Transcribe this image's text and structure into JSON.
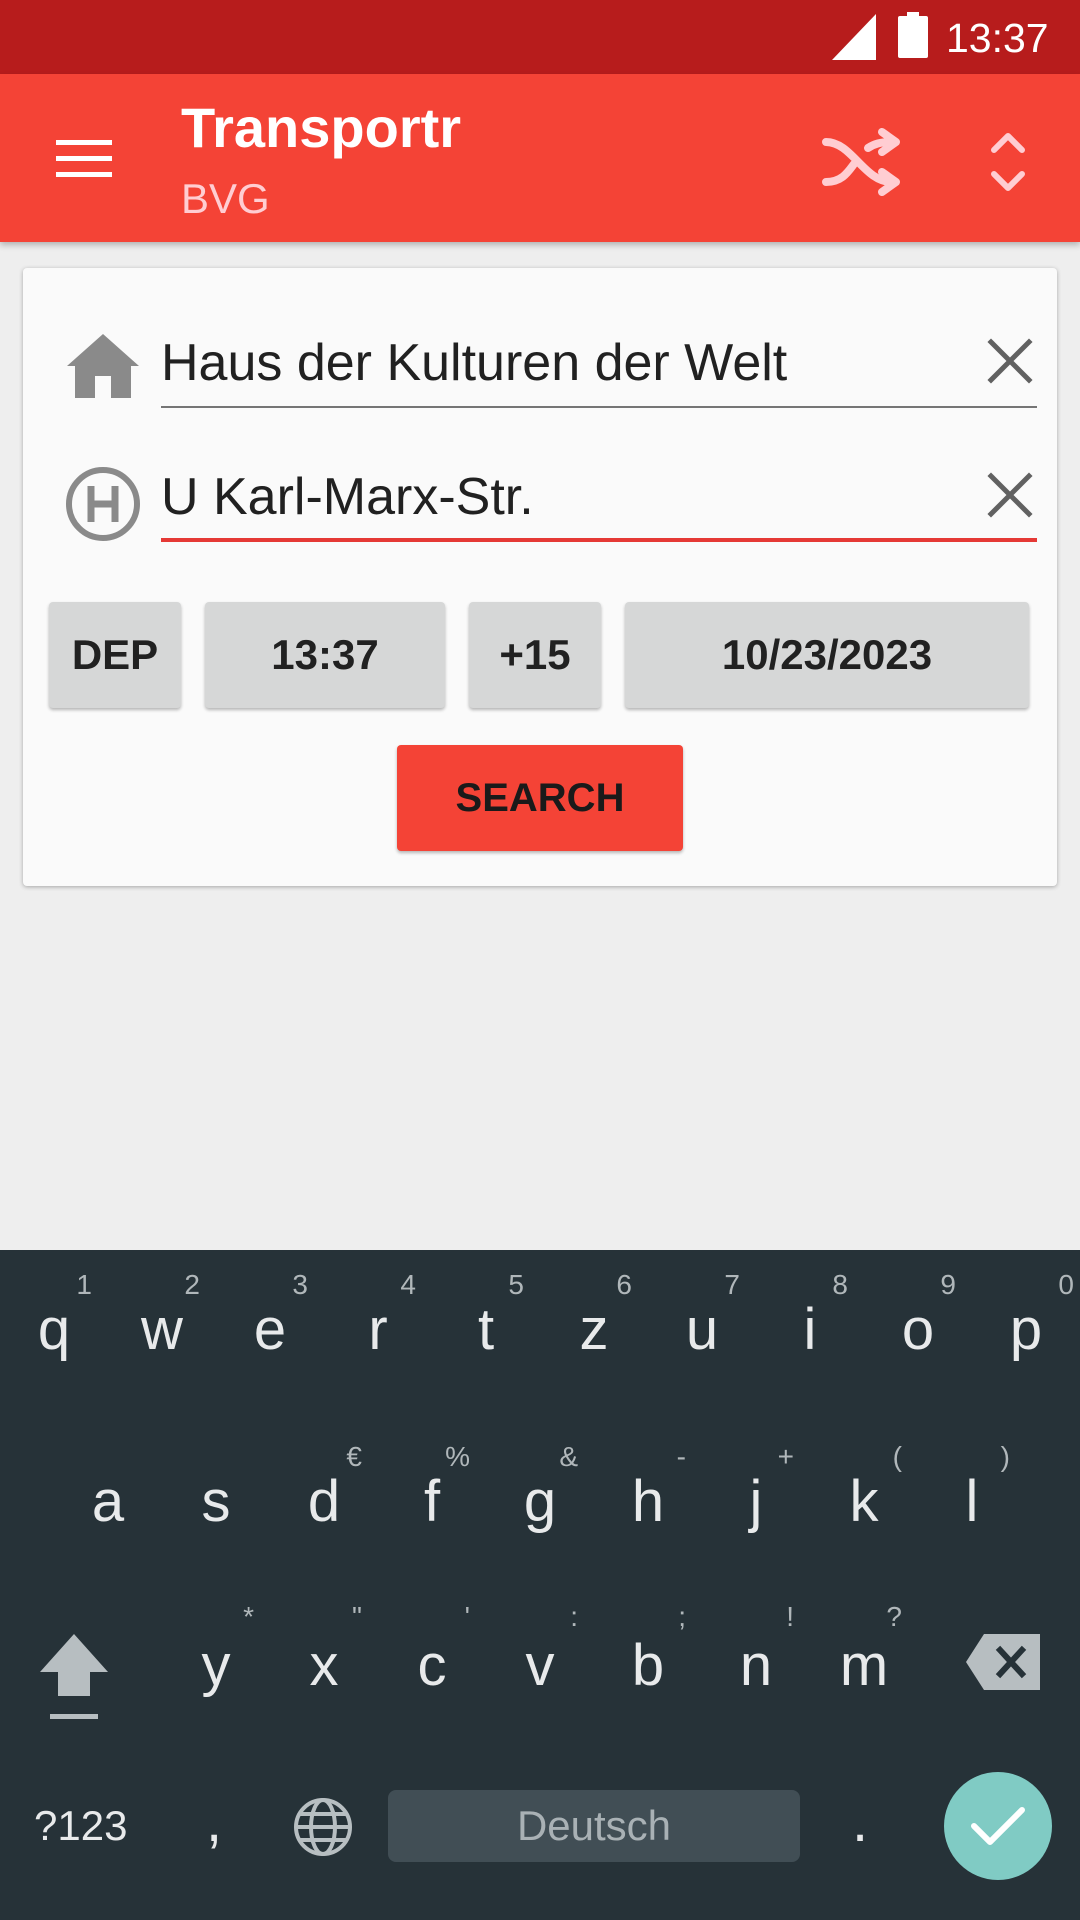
{
  "status_bar": {
    "time": "13:37"
  },
  "app_bar": {
    "title": "Transportr",
    "subtitle": "BVG"
  },
  "search_form": {
    "from": {
      "value": "Haus der Kulturen der Welt"
    },
    "to": {
      "value": "U Karl-Marx-Str."
    },
    "departure_label": "DEP",
    "time": "13:37",
    "time_offset": "+15",
    "date": "10/23/2023",
    "search_label": "SEARCH"
  },
  "keyboard": {
    "row1": [
      {
        "key": "q",
        "hint": "1"
      },
      {
        "key": "w",
        "hint": "2"
      },
      {
        "key": "e",
        "hint": "3"
      },
      {
        "key": "r",
        "hint": "4"
      },
      {
        "key": "t",
        "hint": "5"
      },
      {
        "key": "z",
        "hint": "6"
      },
      {
        "key": "u",
        "hint": "7"
      },
      {
        "key": "i",
        "hint": "8"
      },
      {
        "key": "o",
        "hint": "9"
      },
      {
        "key": "p",
        "hint": "0"
      }
    ],
    "row2": [
      {
        "key": "a",
        "hint": ""
      },
      {
        "key": "s",
        "hint": ""
      },
      {
        "key": "d",
        "hint": "€"
      },
      {
        "key": "f",
        "hint": "%"
      },
      {
        "key": "g",
        "hint": "&"
      },
      {
        "key": "h",
        "hint": "-"
      },
      {
        "key": "j",
        "hint": "+"
      },
      {
        "key": "k",
        "hint": "("
      },
      {
        "key": "l",
        "hint": ")"
      }
    ],
    "row3": [
      {
        "key": "y",
        "hint": "*"
      },
      {
        "key": "x",
        "hint": "\""
      },
      {
        "key": "c",
        "hint": "'"
      },
      {
        "key": "v",
        "hint": ":"
      },
      {
        "key": "b",
        "hint": ";"
      },
      {
        "key": "n",
        "hint": "!"
      },
      {
        "key": "m",
        "hint": "?"
      }
    ],
    "symbols_label": "?123",
    "comma": ",",
    "space_label": "Deutsch",
    "period": "."
  },
  "colors": {
    "status_bar": "#b71c1c",
    "primary": "#f44336",
    "keyboard_bg": "#263238",
    "enter_key": "#80cbc4"
  }
}
